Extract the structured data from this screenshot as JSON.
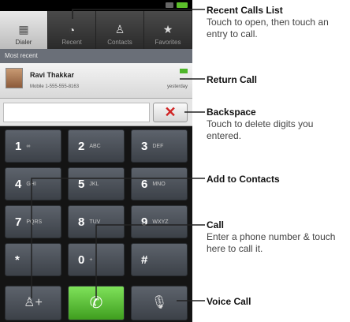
{
  "tabs": [
    {
      "label": "Dialer",
      "icon": "grid-icon"
    },
    {
      "label": "Recent",
      "icon": "clock-icon"
    },
    {
      "label": "Contacts",
      "icon": "person-icon"
    },
    {
      "label": "Favorites",
      "icon": "star-icon"
    }
  ],
  "section_label": "Most recent",
  "recent_call": {
    "name": "Ravi Thakkar",
    "detail": "Mobile 1-555-555-8163",
    "time": "yesterday"
  },
  "keys": [
    {
      "digit": "1",
      "letters": "∞"
    },
    {
      "digit": "2",
      "letters": "ABC"
    },
    {
      "digit": "3",
      "letters": "DEF"
    },
    {
      "digit": "4",
      "letters": "GHI"
    },
    {
      "digit": "5",
      "letters": "JKL"
    },
    {
      "digit": "6",
      "letters": "MNO"
    },
    {
      "digit": "7",
      "letters": "PQRS"
    },
    {
      "digit": "8",
      "letters": "TUV"
    },
    {
      "digit": "9",
      "letters": "WXYZ"
    },
    {
      "digit": "*",
      "letters": ""
    },
    {
      "digit": "0",
      "letters": "+"
    },
    {
      "digit": "#",
      "letters": ""
    }
  ],
  "icons": {
    "backspace": "✕",
    "call": "phone-icon",
    "add": "add-contact-icon",
    "voice": "mic-icon"
  },
  "annotations": {
    "recent_title": "Recent Calls List",
    "recent_desc": "Touch to open, then touch an entry to call.",
    "return_title": "Return Call",
    "backspace_title": "Backspace",
    "backspace_desc": "Touch to delete digits you entered.",
    "add_title": "Add to Contacts",
    "call_title": "Call",
    "call_desc": "Enter a phone number & touch here to call it.",
    "voice_title": "Voice Call"
  },
  "colors": {
    "call_green": "#4fb62a",
    "backspace_red": "#d02424",
    "keypad_key": "#4a5058"
  }
}
